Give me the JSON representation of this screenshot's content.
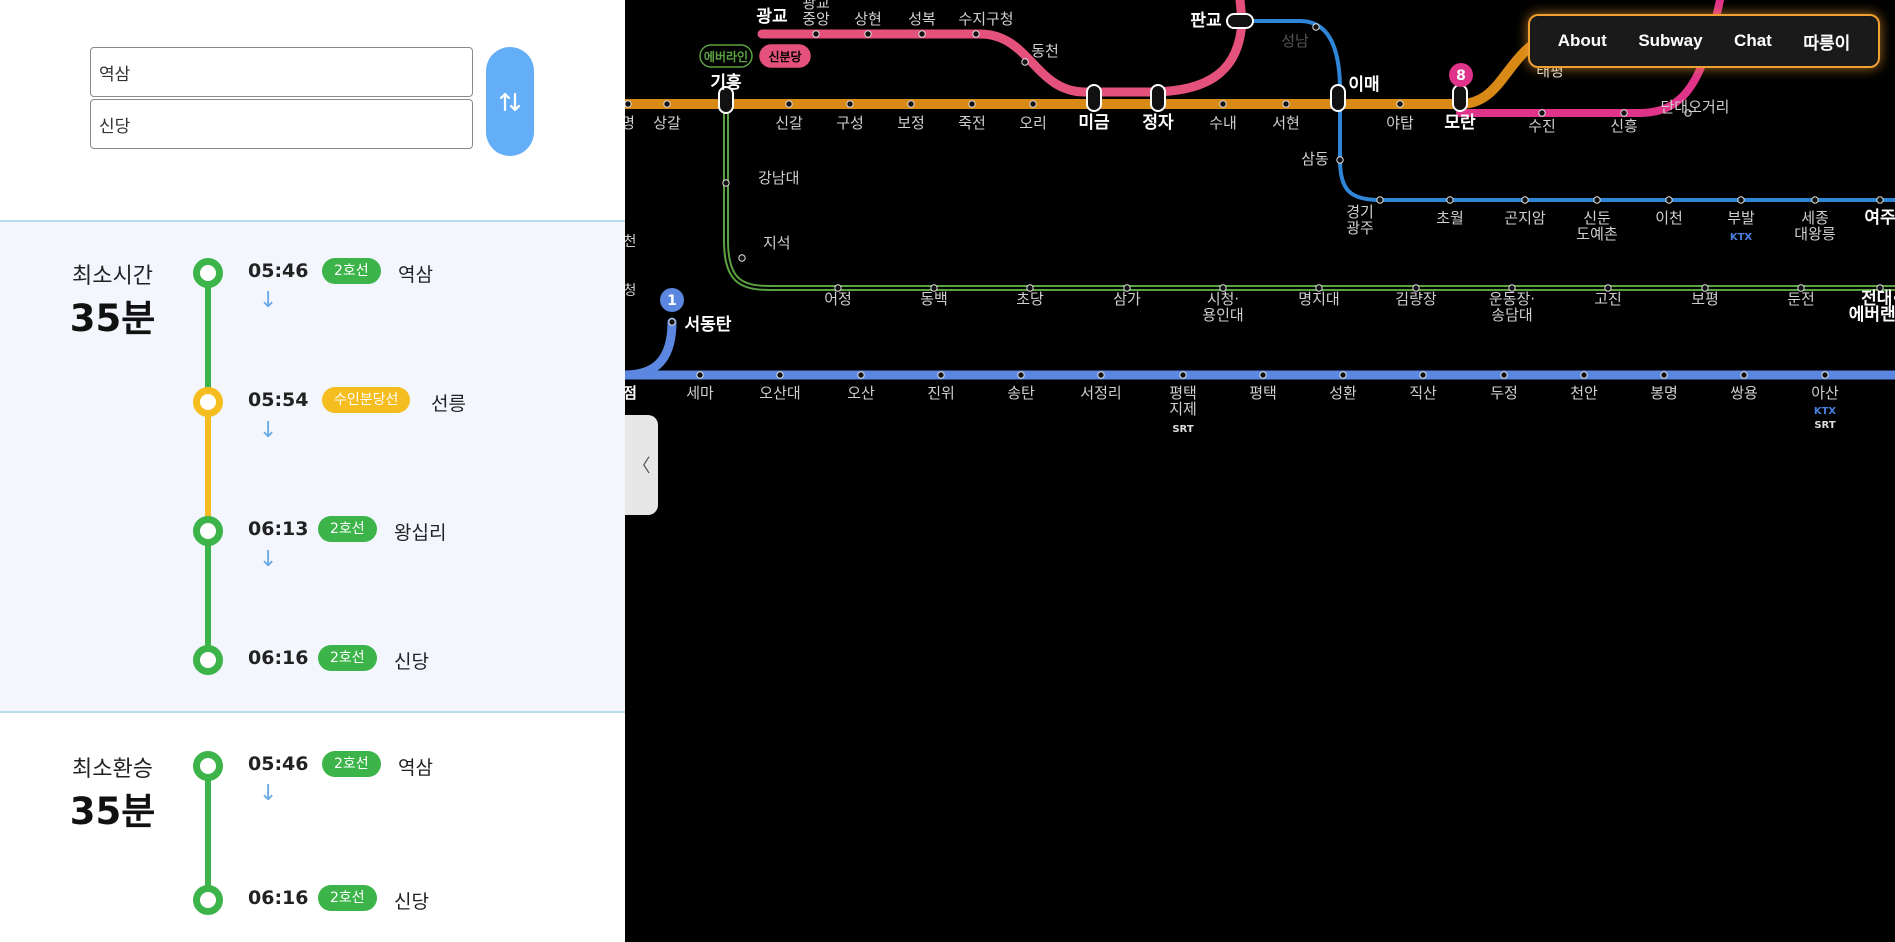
{
  "search": {
    "origin": "역삼",
    "destination": "신당",
    "swap_icon": "swap-vertical-icon"
  },
  "routes": [
    {
      "label": "최소시간",
      "value": "35분",
      "steps": [
        {
          "time": "05:46",
          "line": "2호선",
          "station": "역삼",
          "color": "#3cb44a"
        },
        {
          "time": "05:54",
          "line": "수인분당선",
          "station": "선릉",
          "color": "#f5bd1f"
        },
        {
          "time": "06:13",
          "line": "2호선",
          "station": "왕십리",
          "color": "#3cb44a"
        },
        {
          "time": "06:16",
          "line": "2호선",
          "station": "신당",
          "color": "#3cb44a"
        }
      ]
    },
    {
      "label": "최소환승",
      "value": "35분",
      "steps": [
        {
          "time": "05:46",
          "line": "2호선",
          "station": "역삼",
          "color": "#3cb44a"
        },
        {
          "time": "06:16",
          "line": "2호선",
          "station": "신당",
          "color": "#3cb44a"
        }
      ]
    }
  ],
  "nav": {
    "about": "About",
    "subway": "Subway",
    "chat": "Chat",
    "ttareungi": "따릉이"
  },
  "map": {
    "line_colors": {
      "line1": "#5b87e0",
      "suin_bundang": "#d98a16",
      "sinbundang": "#e4527b",
      "gyeonggang": "#2f86d6",
      "everline": "#5aa241",
      "line8": "#e0338a"
    },
    "badges": {
      "everline": "에버라인",
      "sinbundang": "신분당",
      "line8": "8",
      "line1": "1"
    },
    "top_labels": [
      "광교",
      "광교",
      "중앙",
      "상현",
      "성복",
      "수지구청",
      "동천",
      "판교",
      "성남"
    ],
    "suin_stations": [
      "명",
      "상갈",
      "기흥",
      "신갈",
      "구성",
      "보정",
      "죽전",
      "오리",
      "미금",
      "정자",
      "수내",
      "서현",
      "이매",
      "야탑",
      "모란",
      "태평"
    ],
    "line8_stations": [
      "수진",
      "신흥",
      "단대오거리"
    ],
    "gyeonggang_stations": [
      "삼동",
      "경기\n광주",
      "초월",
      "곤지암",
      "신둔\n도예촌",
      "이천",
      "부발",
      "세종\n대왕릉",
      "여주"
    ],
    "everline_stations": [
      "강남대",
      "지석",
      "어정",
      "동백",
      "초당",
      "삼가",
      "시청·\n용인대",
      "명지대",
      "김량장",
      "운동장·\n송담대",
      "고진",
      "보평",
      "둔전",
      "전대·\n에버랜드"
    ],
    "line1_stations": [
      "서동탄",
      "점",
      "세마",
      "오산대",
      "오산",
      "진위",
      "송탄",
      "서정리",
      "평택\n지제",
      "평택",
      "성환",
      "직산",
      "두정",
      "천안",
      "봉명",
      "쌍용",
      "아산"
    ],
    "rail_tags": {
      "ktx": "KTX",
      "srt": "SRT"
    },
    "edge_glyphs": [
      "천",
      "청"
    ]
  }
}
